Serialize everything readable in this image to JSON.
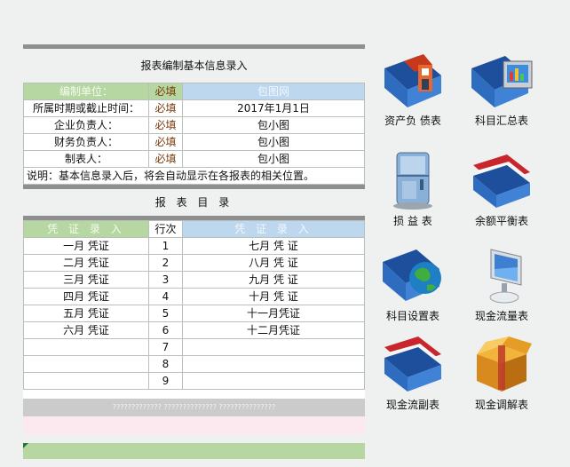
{
  "basic_info": {
    "title": "报表编制基本信息录入",
    "header": {
      "label": "编制单位：",
      "req": "必填",
      "value": "包图网"
    },
    "rows": [
      {
        "label": "所属时期或截止时间：",
        "req": "必填",
        "value": "2017年1月1日"
      },
      {
        "label": "企业负责人：",
        "req": "必填",
        "value": "包小图"
      },
      {
        "label": "财务负责人：",
        "req": "必填",
        "value": "包小图"
      },
      {
        "label": "制表人：",
        "req": "必填",
        "value": "包小图"
      }
    ],
    "note": "说明：基本信息录入后，将会自动显示在各报表的相关位置。"
  },
  "catalog": {
    "title": "报 表 目 录",
    "header": {
      "left": "凭 证 录 入",
      "mid": "行次",
      "right": "凭 证 录 入"
    },
    "rows": [
      {
        "left": "一月 凭证",
        "num": "1",
        "right": "七月 凭 证"
      },
      {
        "left": "二月 凭证",
        "num": "2",
        "right": "八月 凭 证"
      },
      {
        "left": "三月 凭证",
        "num": "3",
        "right": "九月 凭 证"
      },
      {
        "left": "四月 凭证",
        "num": "4",
        "right": "十月 凭 证"
      },
      {
        "left": "五月 凭证",
        "num": "5",
        "right": "十一月凭证"
      },
      {
        "left": "六月 凭证",
        "num": "6",
        "right": "十二月凭证"
      },
      {
        "left": "",
        "num": "7",
        "right": ""
      },
      {
        "left": "",
        "num": "8",
        "right": ""
      },
      {
        "left": "",
        "num": "9",
        "right": ""
      }
    ],
    "footer_text": "????????????? ?????????????? ???????????????"
  },
  "icons": [
    {
      "label": "资产负 债表",
      "icon": "house-folder-icon"
    },
    {
      "label": "科目汇总表",
      "icon": "monitor-folder-icon"
    },
    {
      "label": "损 益 表",
      "icon": "fridge-icon"
    },
    {
      "label": "余额平衡表",
      "icon": "red-folder-icon"
    },
    {
      "label": "科目设置表",
      "icon": "globe-folder-icon"
    },
    {
      "label": "现金流量表",
      "icon": "desktop-computer-icon"
    },
    {
      "label": "现金流副表",
      "icon": "red-blue-folder-icon"
    },
    {
      "label": "现金调解表",
      "icon": "package-box-icon"
    }
  ],
  "colors": {
    "header_green": "#b6d7a1",
    "header_blue": "#bdd7ee",
    "required_text": "#7a3b0c",
    "folder_blue": "#2f6fc2"
  }
}
